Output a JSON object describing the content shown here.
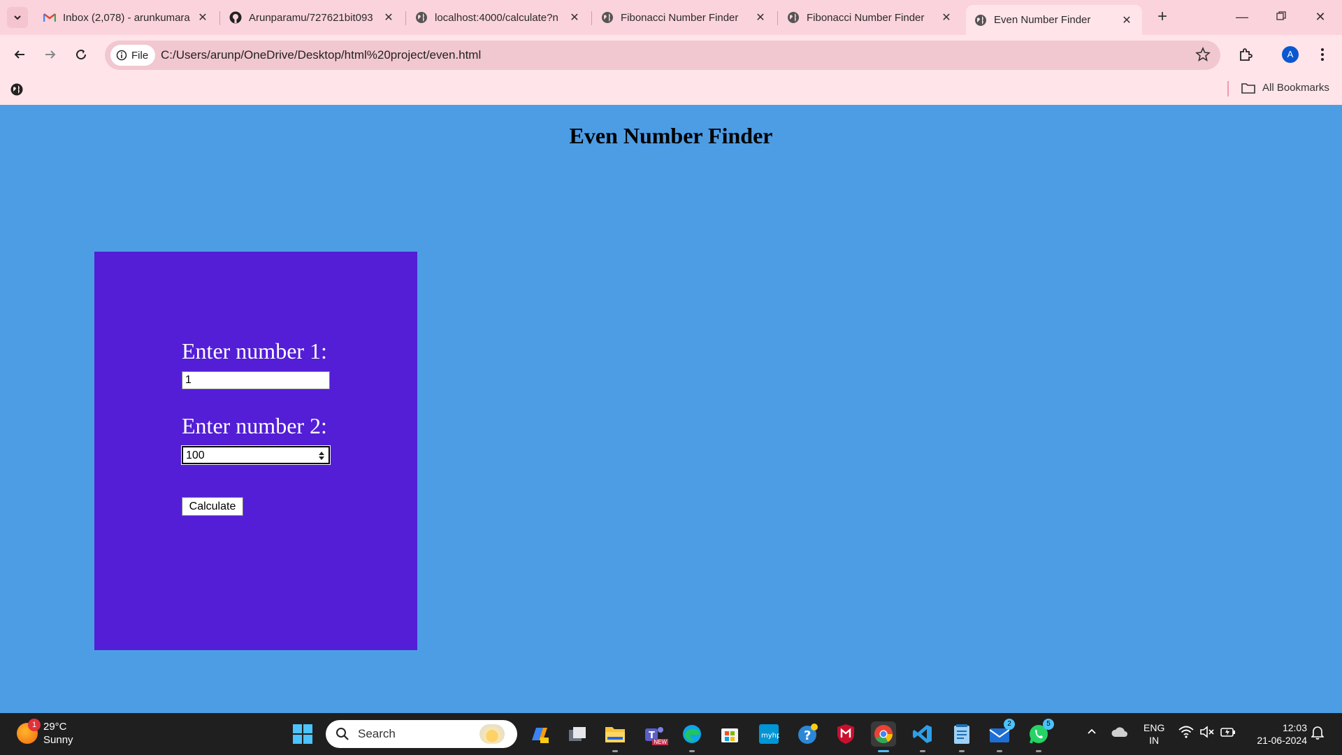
{
  "browser": {
    "tabs": [
      {
        "title": "Inbox (2,078) - arunkumara",
        "icon": "gmail-icon",
        "active": false
      },
      {
        "title": "Arunparamu/727621bit093",
        "icon": "github-icon",
        "active": false
      },
      {
        "title": "localhost:4000/calculate?n",
        "icon": "globe-icon",
        "active": false
      },
      {
        "title": "Fibonacci Number Finder",
        "icon": "globe-icon",
        "active": false
      },
      {
        "title": "Fibonacci Number Finder",
        "icon": "globe-icon",
        "active": false
      },
      {
        "title": "Even Number Finder",
        "icon": "globe-icon",
        "active": true
      }
    ],
    "file_chip": "File",
    "url": "C:/Users/arunp/OneDrive/Desktop/html%20project/even.html",
    "profile_initial": "A",
    "all_bookmarks": "All Bookmarks"
  },
  "page": {
    "title": "Even Number Finder",
    "label1": "Enter number 1:",
    "input1_value": "1",
    "label2": "Enter number 2:",
    "input2_value": "100",
    "button": "Calculate",
    "colors": {
      "background": "#4d9de5",
      "panel": "#531ed6"
    }
  },
  "taskbar": {
    "weather_temp": "29°C",
    "weather_desc": "Sunny",
    "weather_badge": "1",
    "search_label": "Search",
    "teams_badge": "NEW",
    "mail_badge": "2",
    "whatsapp_badge": "5",
    "lang_top": "ENG",
    "lang_bottom": "IN",
    "time": "12:03",
    "date": "21-06-2024"
  }
}
